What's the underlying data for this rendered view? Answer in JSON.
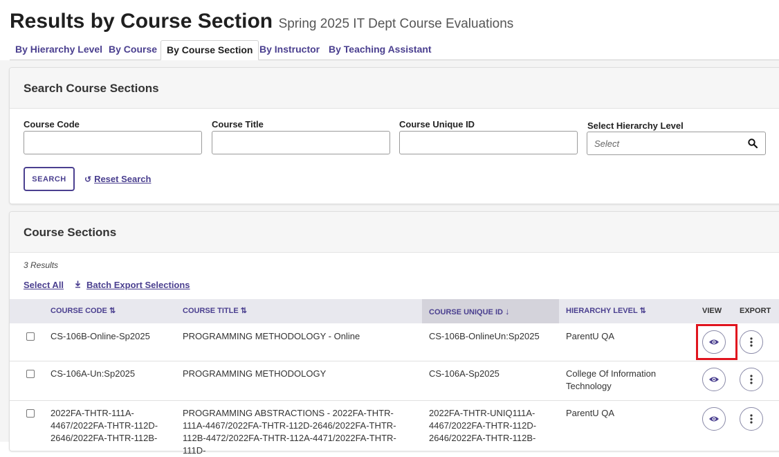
{
  "page": {
    "title": "Results by Course Section",
    "subtitle": "Spring 2025 IT Dept Course Evaluations"
  },
  "tabs": [
    "By Hierarchy Level",
    "By Course",
    "By Course Section",
    "By Instructor",
    "By Teaching Assistant"
  ],
  "search_card": {
    "title": "Search Course Sections",
    "fields": {
      "course_code": "Course Code",
      "course_title": "Course Title",
      "course_unique_id": "Course Unique ID",
      "hierarchy_level": "Select Hierarchy Level"
    },
    "hierarchy_placeholder": "Select",
    "search_button": "SEARCH",
    "reset_link": "Reset Search"
  },
  "sections_card": {
    "title": "Course Sections",
    "results_count": "3 Results",
    "select_all": "Select All",
    "batch_export": "Batch Export Selections",
    "columns": {
      "course_code": "COURSE CODE",
      "course_title": "COURSE TITLE",
      "course_unique_id": "COURSE UNIQUE ID",
      "hierarchy_level": "HIERARCHY LEVEL",
      "view": "VIEW",
      "export": "EXPORT"
    },
    "rows": [
      {
        "code": "CS-106B-Online-Sp2025",
        "title": "PROGRAMMING METHODOLOGY - Online",
        "unique_id": "CS-106B-OnlineUn:Sp2025",
        "hierarchy": "ParentU QA"
      },
      {
        "code": "CS-106A-Un:Sp2025",
        "title": "PROGRAMMING METHODOLOGY",
        "unique_id": "CS-106A-Sp2025",
        "hierarchy": "College Of Information Technology"
      },
      {
        "code": "2022FA-THTR-111A-4467/2022FA-THTR-112D-2646/2022FA-THTR-112B-",
        "title": "PROGRAMMING ABSTRACTIONS - 2022FA-THTR-111A-4467/2022FA-THTR-112D-2646/2022FA-THTR-112B-4472/2022FA-THTR-112A-4471/2022FA-THTR-111D-",
        "unique_id": "2022FA-THTR-UNIQ111A-4467/2022FA-THTR-112D-2646/2022FA-THTR-112B-",
        "hierarchy": "ParentU QA"
      }
    ]
  },
  "icons": {
    "view": "eye-icon",
    "export": "kebab-icon",
    "search": "magnifier-icon",
    "reset": "undo-icon",
    "download": "download-icon"
  },
  "colors": {
    "accent": "#4a3f8f",
    "highlight": "#e0141e"
  }
}
